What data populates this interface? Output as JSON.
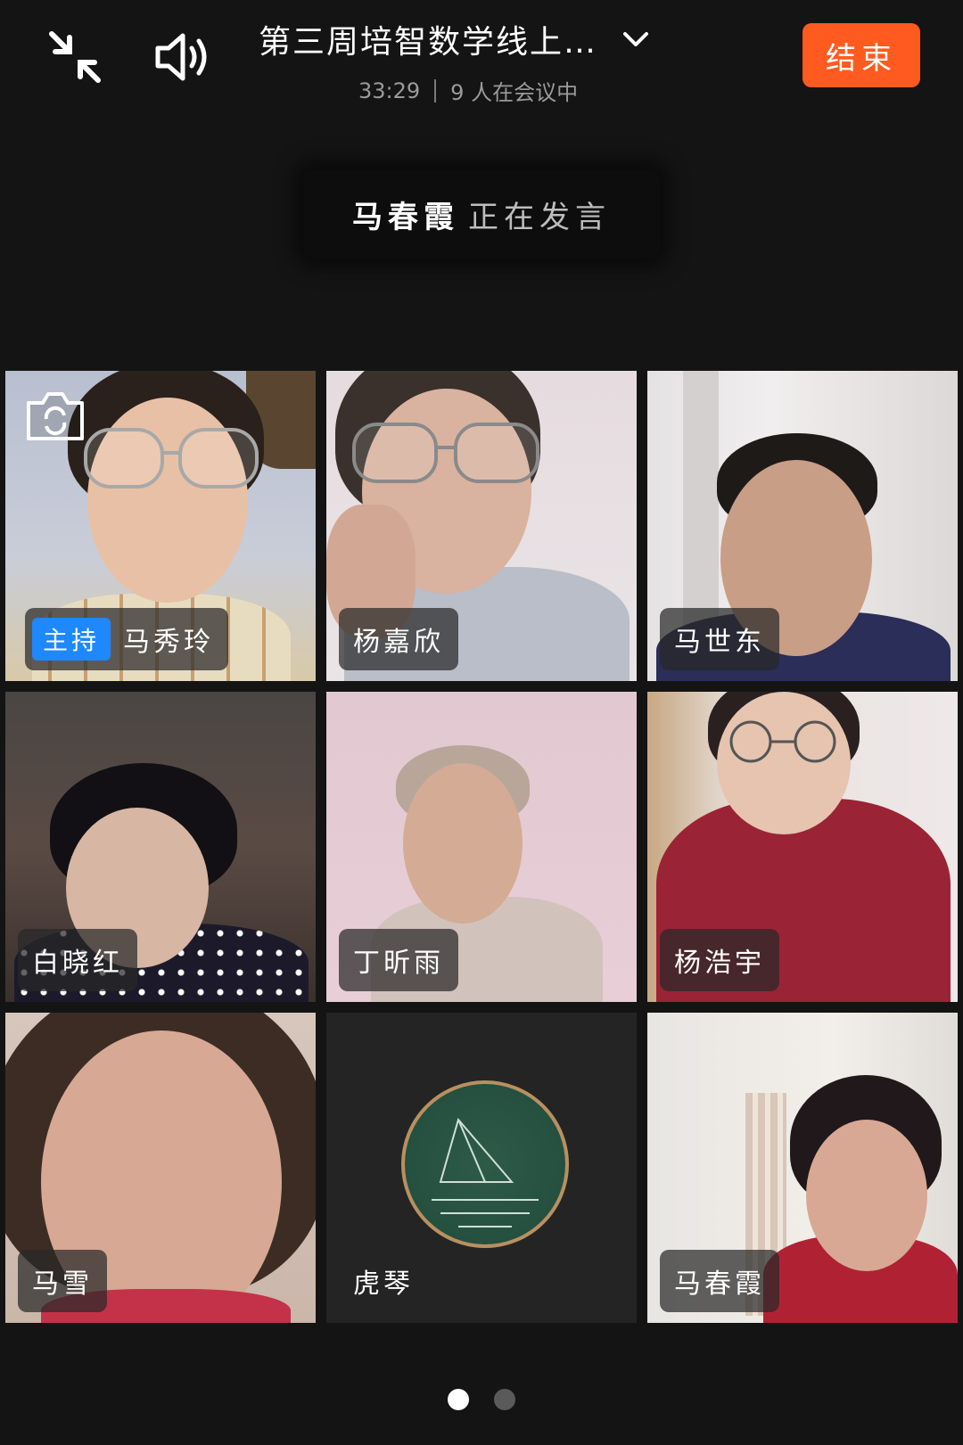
{
  "header": {
    "title": "第三周培智数学线上…",
    "duration": "33:29",
    "participants": "9 人在会议中",
    "end_label": "结束"
  },
  "speaking": {
    "name": "马春霞",
    "action": "正在发言"
  },
  "host_badge": "主持",
  "participants": [
    {
      "name": "马秀玲",
      "host": true
    },
    {
      "name": "杨嘉欣"
    },
    {
      "name": "马世东"
    },
    {
      "name": "白晓红"
    },
    {
      "name": "丁昕雨"
    },
    {
      "name": "杨浩宇"
    },
    {
      "name": "马雪"
    },
    {
      "name": "虎琴"
    },
    {
      "name": "马春霞",
      "active_speaker": true
    }
  ],
  "pager": {
    "pages": 2,
    "current": 1
  },
  "colors": {
    "background": "#141414",
    "end_button": "#ff5a1f",
    "host_badge": "#1e88ff",
    "active_border": "#1ec45a"
  }
}
